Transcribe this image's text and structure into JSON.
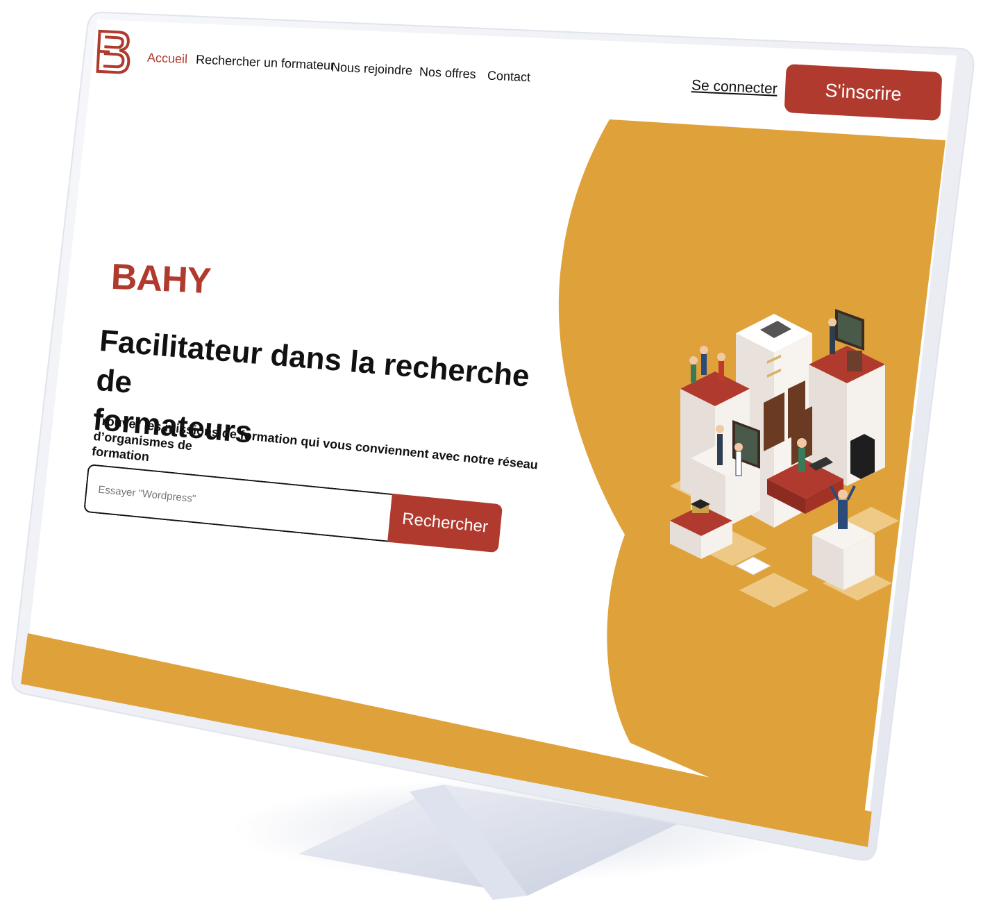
{
  "nav": {
    "items": [
      {
        "label": "Accueil",
        "active": true
      },
      {
        "label": "Rechercher un formateur",
        "active": false
      },
      {
        "label": "Nous rejoindre",
        "active": false
      },
      {
        "label": "Nos offres",
        "active": false
      },
      {
        "label": "Contact",
        "active": false
      }
    ],
    "login_label": "Se connecter",
    "signup_label": "S'inscrire"
  },
  "hero": {
    "brand": "BAHY",
    "title_line1": "Facilitateur dans la recherche de",
    "title_line2": "formateurs",
    "subtitle_line1": "Trouver les missions de formation qui vous conviennent avec notre réseau d’organismes de",
    "subtitle_line2": "formation"
  },
  "search": {
    "placeholder": "Essayer \"Wordpress\"",
    "button_label": "Rechercher"
  },
  "colors": {
    "accent": "#b03a2e",
    "mustard": "#dfa13a",
    "text": "#111111",
    "bezel": "#f1f2f6"
  },
  "icons": {
    "logo": "stylized-b-logo",
    "illustration": "isometric-training-illustration"
  }
}
